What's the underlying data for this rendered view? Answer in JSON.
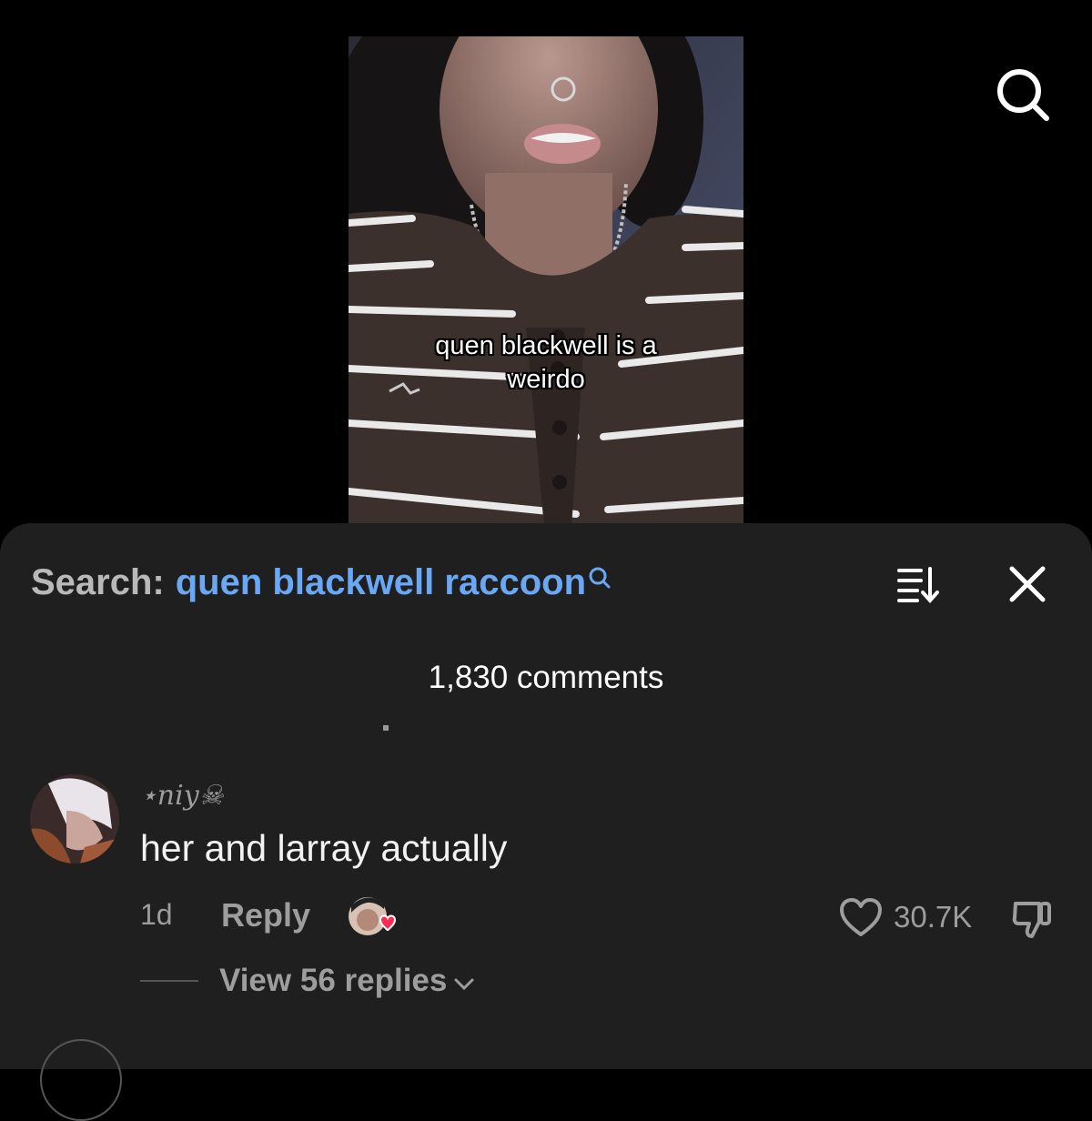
{
  "video": {
    "caption_line1": "quen blackwell is a",
    "caption_line2": "weirdo"
  },
  "top_search_icon": "search-icon",
  "sheet": {
    "search_prefix": "Search:",
    "search_query": "quen blackwell raccoon",
    "sort_icon": "sort-icon",
    "close_icon": "close-icon",
    "comment_count": "1,830 comments"
  },
  "comment": {
    "username": "⋆niy☠",
    "text": "her and larray actually",
    "time": "1d",
    "reply_label": "Reply",
    "creator_liked_icon": "creator-liked-heart-icon",
    "like_count": "30.7K",
    "like_icon": "heart-outline-icon",
    "dislike_icon": "thumbs-down-icon",
    "view_replies": "View 56 replies"
  },
  "colors": {
    "background": "#000000",
    "sheet": "#1f1f1f",
    "accent_blue": "#6aa8f5",
    "muted_text": "#9d9d9d",
    "heart_red": "#fe2c55"
  }
}
